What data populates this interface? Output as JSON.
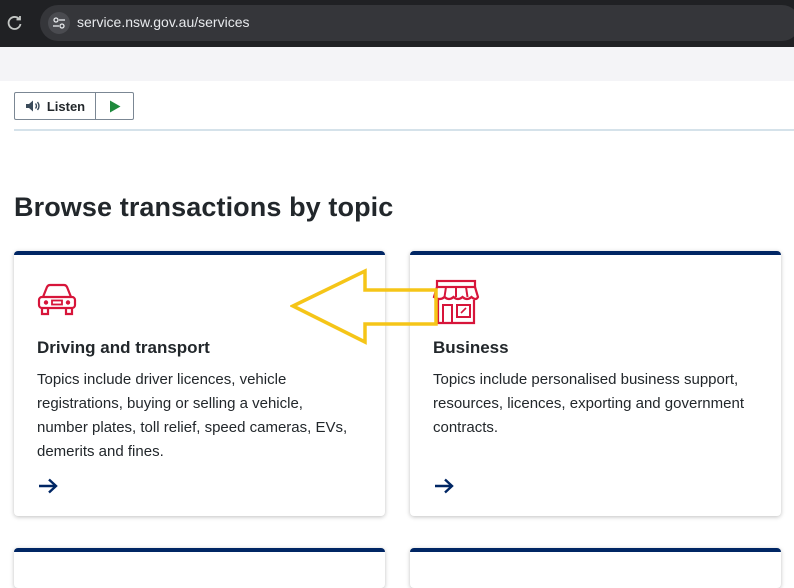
{
  "browser": {
    "url": "service.nsw.gov.au/services"
  },
  "listen": {
    "label": "Listen"
  },
  "page": {
    "title": "Browse transactions by topic"
  },
  "cards": [
    {
      "title": "Driving and transport",
      "description": "Topics include driver licences, vehicle registrations, buying or selling a vehicle, number plates, toll relief, speed cameras, EVs, demerits and fines.",
      "icon": "car-icon"
    },
    {
      "title": "Business",
      "description": "Topics include personalised business support, resources, licences, exporting and government contracts.",
      "icon": "shopfront-icon"
    }
  ],
  "colors": {
    "accent_red": "#d7153a",
    "nav_blue": "#002664",
    "annotation_yellow": "#f5c518"
  }
}
